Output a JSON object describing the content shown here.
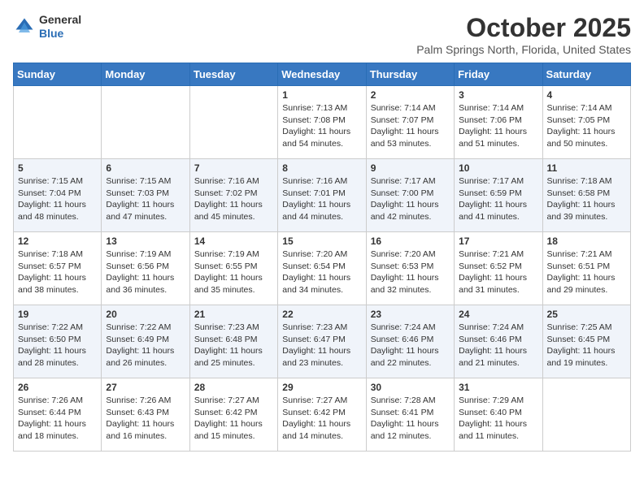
{
  "logo": {
    "general": "General",
    "blue": "Blue"
  },
  "header": {
    "month": "October 2025",
    "location": "Palm Springs North, Florida, United States"
  },
  "weekdays": [
    "Sunday",
    "Monday",
    "Tuesday",
    "Wednesday",
    "Thursday",
    "Friday",
    "Saturday"
  ],
  "weeks": [
    [
      {
        "day": "",
        "sunrise": "",
        "sunset": "",
        "daylight": ""
      },
      {
        "day": "",
        "sunrise": "",
        "sunset": "",
        "daylight": ""
      },
      {
        "day": "",
        "sunrise": "",
        "sunset": "",
        "daylight": ""
      },
      {
        "day": "1",
        "sunrise": "Sunrise: 7:13 AM",
        "sunset": "Sunset: 7:08 PM",
        "daylight": "Daylight: 11 hours and 54 minutes."
      },
      {
        "day": "2",
        "sunrise": "Sunrise: 7:14 AM",
        "sunset": "Sunset: 7:07 PM",
        "daylight": "Daylight: 11 hours and 53 minutes."
      },
      {
        "day": "3",
        "sunrise": "Sunrise: 7:14 AM",
        "sunset": "Sunset: 7:06 PM",
        "daylight": "Daylight: 11 hours and 51 minutes."
      },
      {
        "day": "4",
        "sunrise": "Sunrise: 7:14 AM",
        "sunset": "Sunset: 7:05 PM",
        "daylight": "Daylight: 11 hours and 50 minutes."
      }
    ],
    [
      {
        "day": "5",
        "sunrise": "Sunrise: 7:15 AM",
        "sunset": "Sunset: 7:04 PM",
        "daylight": "Daylight: 11 hours and 48 minutes."
      },
      {
        "day": "6",
        "sunrise": "Sunrise: 7:15 AM",
        "sunset": "Sunset: 7:03 PM",
        "daylight": "Daylight: 11 hours and 47 minutes."
      },
      {
        "day": "7",
        "sunrise": "Sunrise: 7:16 AM",
        "sunset": "Sunset: 7:02 PM",
        "daylight": "Daylight: 11 hours and 45 minutes."
      },
      {
        "day": "8",
        "sunrise": "Sunrise: 7:16 AM",
        "sunset": "Sunset: 7:01 PM",
        "daylight": "Daylight: 11 hours and 44 minutes."
      },
      {
        "day": "9",
        "sunrise": "Sunrise: 7:17 AM",
        "sunset": "Sunset: 7:00 PM",
        "daylight": "Daylight: 11 hours and 42 minutes."
      },
      {
        "day": "10",
        "sunrise": "Sunrise: 7:17 AM",
        "sunset": "Sunset: 6:59 PM",
        "daylight": "Daylight: 11 hours and 41 minutes."
      },
      {
        "day": "11",
        "sunrise": "Sunrise: 7:18 AM",
        "sunset": "Sunset: 6:58 PM",
        "daylight": "Daylight: 11 hours and 39 minutes."
      }
    ],
    [
      {
        "day": "12",
        "sunrise": "Sunrise: 7:18 AM",
        "sunset": "Sunset: 6:57 PM",
        "daylight": "Daylight: 11 hours and 38 minutes."
      },
      {
        "day": "13",
        "sunrise": "Sunrise: 7:19 AM",
        "sunset": "Sunset: 6:56 PM",
        "daylight": "Daylight: 11 hours and 36 minutes."
      },
      {
        "day": "14",
        "sunrise": "Sunrise: 7:19 AM",
        "sunset": "Sunset: 6:55 PM",
        "daylight": "Daylight: 11 hours and 35 minutes."
      },
      {
        "day": "15",
        "sunrise": "Sunrise: 7:20 AM",
        "sunset": "Sunset: 6:54 PM",
        "daylight": "Daylight: 11 hours and 34 minutes."
      },
      {
        "day": "16",
        "sunrise": "Sunrise: 7:20 AM",
        "sunset": "Sunset: 6:53 PM",
        "daylight": "Daylight: 11 hours and 32 minutes."
      },
      {
        "day": "17",
        "sunrise": "Sunrise: 7:21 AM",
        "sunset": "Sunset: 6:52 PM",
        "daylight": "Daylight: 11 hours and 31 minutes."
      },
      {
        "day": "18",
        "sunrise": "Sunrise: 7:21 AM",
        "sunset": "Sunset: 6:51 PM",
        "daylight": "Daylight: 11 hours and 29 minutes."
      }
    ],
    [
      {
        "day": "19",
        "sunrise": "Sunrise: 7:22 AM",
        "sunset": "Sunset: 6:50 PM",
        "daylight": "Daylight: 11 hours and 28 minutes."
      },
      {
        "day": "20",
        "sunrise": "Sunrise: 7:22 AM",
        "sunset": "Sunset: 6:49 PM",
        "daylight": "Daylight: 11 hours and 26 minutes."
      },
      {
        "day": "21",
        "sunrise": "Sunrise: 7:23 AM",
        "sunset": "Sunset: 6:48 PM",
        "daylight": "Daylight: 11 hours and 25 minutes."
      },
      {
        "day": "22",
        "sunrise": "Sunrise: 7:23 AM",
        "sunset": "Sunset: 6:47 PM",
        "daylight": "Daylight: 11 hours and 23 minutes."
      },
      {
        "day": "23",
        "sunrise": "Sunrise: 7:24 AM",
        "sunset": "Sunset: 6:46 PM",
        "daylight": "Daylight: 11 hours and 22 minutes."
      },
      {
        "day": "24",
        "sunrise": "Sunrise: 7:24 AM",
        "sunset": "Sunset: 6:46 PM",
        "daylight": "Daylight: 11 hours and 21 minutes."
      },
      {
        "day": "25",
        "sunrise": "Sunrise: 7:25 AM",
        "sunset": "Sunset: 6:45 PM",
        "daylight": "Daylight: 11 hours and 19 minutes."
      }
    ],
    [
      {
        "day": "26",
        "sunrise": "Sunrise: 7:26 AM",
        "sunset": "Sunset: 6:44 PM",
        "daylight": "Daylight: 11 hours and 18 minutes."
      },
      {
        "day": "27",
        "sunrise": "Sunrise: 7:26 AM",
        "sunset": "Sunset: 6:43 PM",
        "daylight": "Daylight: 11 hours and 16 minutes."
      },
      {
        "day": "28",
        "sunrise": "Sunrise: 7:27 AM",
        "sunset": "Sunset: 6:42 PM",
        "daylight": "Daylight: 11 hours and 15 minutes."
      },
      {
        "day": "29",
        "sunrise": "Sunrise: 7:27 AM",
        "sunset": "Sunset: 6:42 PM",
        "daylight": "Daylight: 11 hours and 14 minutes."
      },
      {
        "day": "30",
        "sunrise": "Sunrise: 7:28 AM",
        "sunset": "Sunset: 6:41 PM",
        "daylight": "Daylight: 11 hours and 12 minutes."
      },
      {
        "day": "31",
        "sunrise": "Sunrise: 7:29 AM",
        "sunset": "Sunset: 6:40 PM",
        "daylight": "Daylight: 11 hours and 11 minutes."
      },
      {
        "day": "",
        "sunrise": "",
        "sunset": "",
        "daylight": ""
      }
    ]
  ]
}
